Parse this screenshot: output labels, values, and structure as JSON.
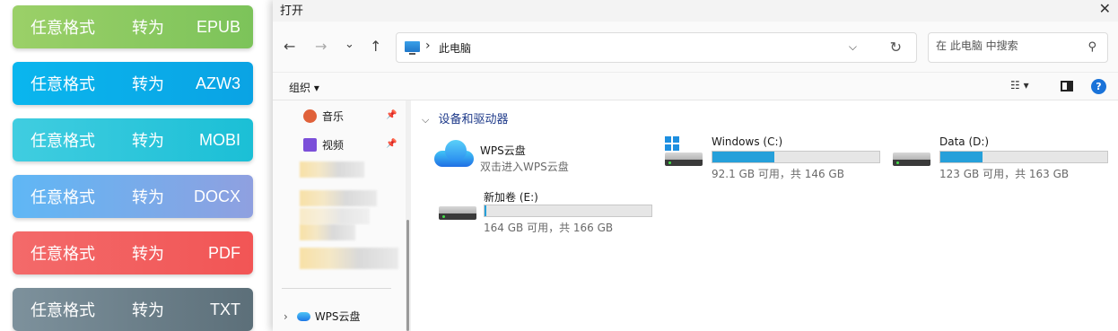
{
  "convert_buttons": [
    {
      "prefix": "任意格式",
      "verb": "转为",
      "format": "EPUB",
      "color_from": "#9bd068",
      "color_to": "#7cc35a"
    },
    {
      "prefix": "任意格式",
      "verb": "转为",
      "format": "AZW3",
      "color_from": "#0ab6ee",
      "color_to": "#0aa3e4"
    },
    {
      "prefix": "任意格式",
      "verb": "转为",
      "format": "MOBI",
      "color_from": "#40cde0",
      "color_to": "#1bbfd6"
    },
    {
      "prefix": "任意格式",
      "verb": "转为",
      "format": "DOCX",
      "color_from": "#5fb7f5",
      "color_to": "#8fa0e0"
    },
    {
      "prefix": "任意格式",
      "verb": "转为",
      "format": "PDF",
      "color_from": "#f36a6a",
      "color_to": "#f25555"
    },
    {
      "prefix": "任意格式",
      "verb": "转为",
      "format": "TXT",
      "color_from": "#7d919c",
      "color_to": "#5c6f79"
    }
  ],
  "dialog": {
    "title": "打开",
    "close_glyph": "✕",
    "nav": {
      "back": "←",
      "forward": "→",
      "recent": "⌄",
      "up": "↑"
    },
    "address": {
      "separator": "›",
      "path": "此电脑",
      "dropdown": "⌵",
      "refresh": "↻"
    },
    "search": {
      "placeholder": "在 此电脑 中搜索",
      "icon": "⚲"
    },
    "toolbar": {
      "organize": "组织 ▾",
      "view": "☷ ▾",
      "help": "?"
    },
    "nav_pane": {
      "items": [
        {
          "label": "音乐",
          "icon": "music-icon",
          "pinned": true
        },
        {
          "label": "视频",
          "icon": "video-icon",
          "pinned": true
        }
      ],
      "pin_glyph": "📌",
      "wps_cloud": {
        "chevron": "›",
        "label": "WPS云盘"
      }
    },
    "content": {
      "group_header": {
        "chevron": "⌵",
        "label": "设备和驱动器"
      },
      "wps": {
        "name": "WPS云盘",
        "subtitle": "双击进入WPS云盘"
      },
      "drives": [
        {
          "name": "Windows (C:)",
          "free": "92.1 GB 可用，共 146 GB",
          "used_fraction": 0.37,
          "icon": "windows-drive-icon"
        },
        {
          "name": "Data (D:)",
          "free": "123 GB 可用，共 163 GB",
          "used_fraction": 0.25,
          "icon": "hdd-icon"
        },
        {
          "name": "新加卷 (E:)",
          "free": "164 GB 可用，共 166 GB",
          "used_fraction": 0.012,
          "icon": "hdd-icon"
        }
      ]
    }
  }
}
